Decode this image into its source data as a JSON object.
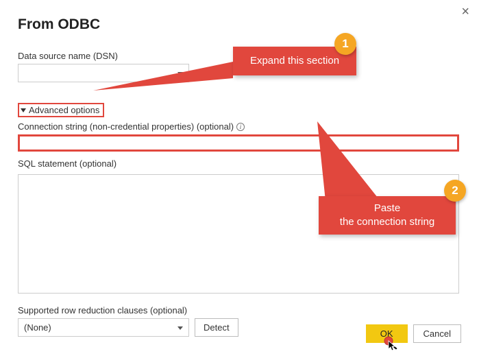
{
  "window": {
    "title": "From ODBC"
  },
  "dsn": {
    "label": "Data source name (DSN)",
    "value": ""
  },
  "advanced": {
    "toggle_label": "Advanced options",
    "cs_label": "Connection string (non-credential properties) (optional)",
    "cs_value": "",
    "sql_label": "SQL statement (optional)",
    "sql_value": "",
    "rr_label": "Supported row reduction clauses (optional)",
    "rr_selected": "(None)",
    "detect_label": "Detect"
  },
  "buttons": {
    "ok": "OK",
    "cancel": "Cancel"
  },
  "annotations": {
    "callout1": "Expand this section",
    "callout2_line1": "Paste",
    "callout2_line2": "the connection string",
    "badge1": "1",
    "badge2": "2"
  }
}
